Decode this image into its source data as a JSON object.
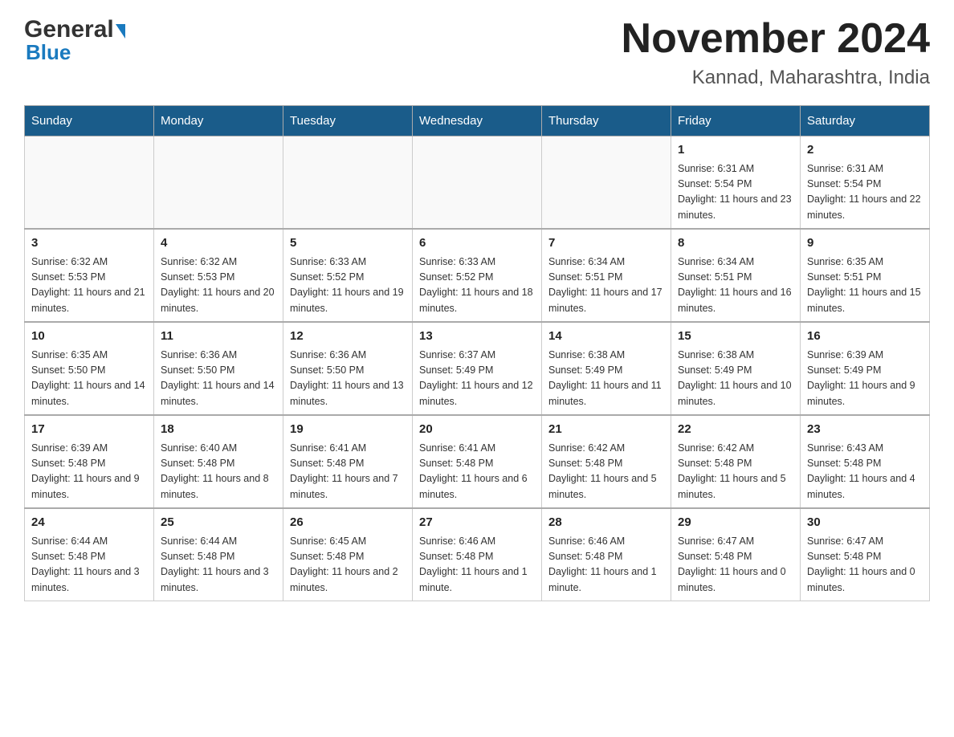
{
  "header": {
    "logo_general": "General",
    "logo_blue": "Blue",
    "main_title": "November 2024",
    "subtitle": "Kannad, Maharashtra, India"
  },
  "calendar": {
    "days_of_week": [
      "Sunday",
      "Monday",
      "Tuesday",
      "Wednesday",
      "Thursday",
      "Friday",
      "Saturday"
    ],
    "weeks": [
      [
        {
          "day": "",
          "info": ""
        },
        {
          "day": "",
          "info": ""
        },
        {
          "day": "",
          "info": ""
        },
        {
          "day": "",
          "info": ""
        },
        {
          "day": "",
          "info": ""
        },
        {
          "day": "1",
          "info": "Sunrise: 6:31 AM\nSunset: 5:54 PM\nDaylight: 11 hours and 23 minutes."
        },
        {
          "day": "2",
          "info": "Sunrise: 6:31 AM\nSunset: 5:54 PM\nDaylight: 11 hours and 22 minutes."
        }
      ],
      [
        {
          "day": "3",
          "info": "Sunrise: 6:32 AM\nSunset: 5:53 PM\nDaylight: 11 hours and 21 minutes."
        },
        {
          "day": "4",
          "info": "Sunrise: 6:32 AM\nSunset: 5:53 PM\nDaylight: 11 hours and 20 minutes."
        },
        {
          "day": "5",
          "info": "Sunrise: 6:33 AM\nSunset: 5:52 PM\nDaylight: 11 hours and 19 minutes."
        },
        {
          "day": "6",
          "info": "Sunrise: 6:33 AM\nSunset: 5:52 PM\nDaylight: 11 hours and 18 minutes."
        },
        {
          "day": "7",
          "info": "Sunrise: 6:34 AM\nSunset: 5:51 PM\nDaylight: 11 hours and 17 minutes."
        },
        {
          "day": "8",
          "info": "Sunrise: 6:34 AM\nSunset: 5:51 PM\nDaylight: 11 hours and 16 minutes."
        },
        {
          "day": "9",
          "info": "Sunrise: 6:35 AM\nSunset: 5:51 PM\nDaylight: 11 hours and 15 minutes."
        }
      ],
      [
        {
          "day": "10",
          "info": "Sunrise: 6:35 AM\nSunset: 5:50 PM\nDaylight: 11 hours and 14 minutes."
        },
        {
          "day": "11",
          "info": "Sunrise: 6:36 AM\nSunset: 5:50 PM\nDaylight: 11 hours and 14 minutes."
        },
        {
          "day": "12",
          "info": "Sunrise: 6:36 AM\nSunset: 5:50 PM\nDaylight: 11 hours and 13 minutes."
        },
        {
          "day": "13",
          "info": "Sunrise: 6:37 AM\nSunset: 5:49 PM\nDaylight: 11 hours and 12 minutes."
        },
        {
          "day": "14",
          "info": "Sunrise: 6:38 AM\nSunset: 5:49 PM\nDaylight: 11 hours and 11 minutes."
        },
        {
          "day": "15",
          "info": "Sunrise: 6:38 AM\nSunset: 5:49 PM\nDaylight: 11 hours and 10 minutes."
        },
        {
          "day": "16",
          "info": "Sunrise: 6:39 AM\nSunset: 5:49 PM\nDaylight: 11 hours and 9 minutes."
        }
      ],
      [
        {
          "day": "17",
          "info": "Sunrise: 6:39 AM\nSunset: 5:48 PM\nDaylight: 11 hours and 9 minutes."
        },
        {
          "day": "18",
          "info": "Sunrise: 6:40 AM\nSunset: 5:48 PM\nDaylight: 11 hours and 8 minutes."
        },
        {
          "day": "19",
          "info": "Sunrise: 6:41 AM\nSunset: 5:48 PM\nDaylight: 11 hours and 7 minutes."
        },
        {
          "day": "20",
          "info": "Sunrise: 6:41 AM\nSunset: 5:48 PM\nDaylight: 11 hours and 6 minutes."
        },
        {
          "day": "21",
          "info": "Sunrise: 6:42 AM\nSunset: 5:48 PM\nDaylight: 11 hours and 5 minutes."
        },
        {
          "day": "22",
          "info": "Sunrise: 6:42 AM\nSunset: 5:48 PM\nDaylight: 11 hours and 5 minutes."
        },
        {
          "day": "23",
          "info": "Sunrise: 6:43 AM\nSunset: 5:48 PM\nDaylight: 11 hours and 4 minutes."
        }
      ],
      [
        {
          "day": "24",
          "info": "Sunrise: 6:44 AM\nSunset: 5:48 PM\nDaylight: 11 hours and 3 minutes."
        },
        {
          "day": "25",
          "info": "Sunrise: 6:44 AM\nSunset: 5:48 PM\nDaylight: 11 hours and 3 minutes."
        },
        {
          "day": "26",
          "info": "Sunrise: 6:45 AM\nSunset: 5:48 PM\nDaylight: 11 hours and 2 minutes."
        },
        {
          "day": "27",
          "info": "Sunrise: 6:46 AM\nSunset: 5:48 PM\nDaylight: 11 hours and 1 minute."
        },
        {
          "day": "28",
          "info": "Sunrise: 6:46 AM\nSunset: 5:48 PM\nDaylight: 11 hours and 1 minute."
        },
        {
          "day": "29",
          "info": "Sunrise: 6:47 AM\nSunset: 5:48 PM\nDaylight: 11 hours and 0 minutes."
        },
        {
          "day": "30",
          "info": "Sunrise: 6:47 AM\nSunset: 5:48 PM\nDaylight: 11 hours and 0 minutes."
        }
      ]
    ]
  }
}
